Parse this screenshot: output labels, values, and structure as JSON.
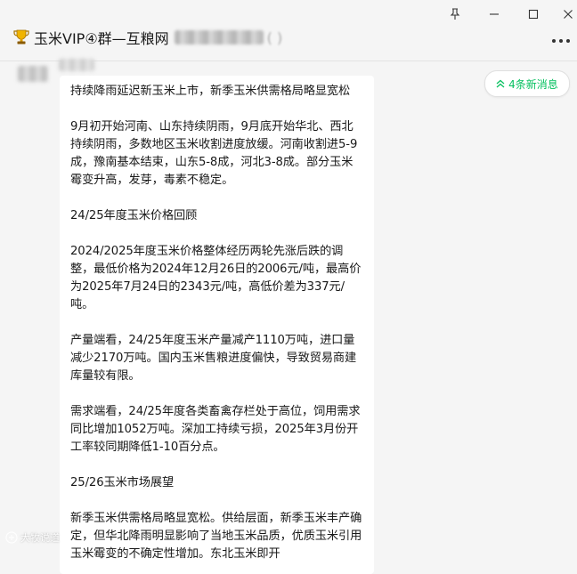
{
  "window": {
    "title_visible": "玉米VIP④群—互粮网",
    "title_suffix_visible": "(   )"
  },
  "controls": {
    "pin": "pin-icon",
    "minimize": "minimize-icon",
    "maximize": "maximize-icon",
    "close": "close-icon",
    "more": "more-icon"
  },
  "new_messages": {
    "label": "4条新消息",
    "color": "#07c160"
  },
  "message": {
    "paragraphs": [
      "持续降雨延迟新玉米上市，新季玉米供需格局略显宽松",
      "9月初开始河南、山东持续阴雨，9月底开始华北、西北持续阴雨，多数地区玉米收割进度放缓。河南收割进5-9成，豫南基本结束，山东5-8成，河北3-8成。部分玉米霉变升高，发芽，毒素不稳定。",
      "24/25年度玉米价格回顾",
      "2024/2025年度玉米价格整体经历两轮先涨后跌的调整，最低价格为2024年12月26日的2006元/吨，最高价为2025年7月24日的2343元/吨，高低价差为337元/吨。",
      "产量端看，24/25年度玉米产量减产1110万吨，进口量减少2170万吨。国内玉米售粮进度偏快，导致贸易商建库量较有限。",
      "需求端看，24/25年度各类畜禽存栏处于高位，饲用需求同比增加1052万吨。深加工持续亏损，2025年3月份开工率较同期降低1-10百分点。",
      "25/26玉米市场展望",
      "新季玉米供需格局略显宽松。供给层面，新季玉米丰产确定，但华北降雨明显影响了当地玉米品质，优质玉米引用玉米霉变的不确定性增加。东北玉米即开"
    ]
  },
  "watermark": {
    "label": "大牧说道"
  }
}
